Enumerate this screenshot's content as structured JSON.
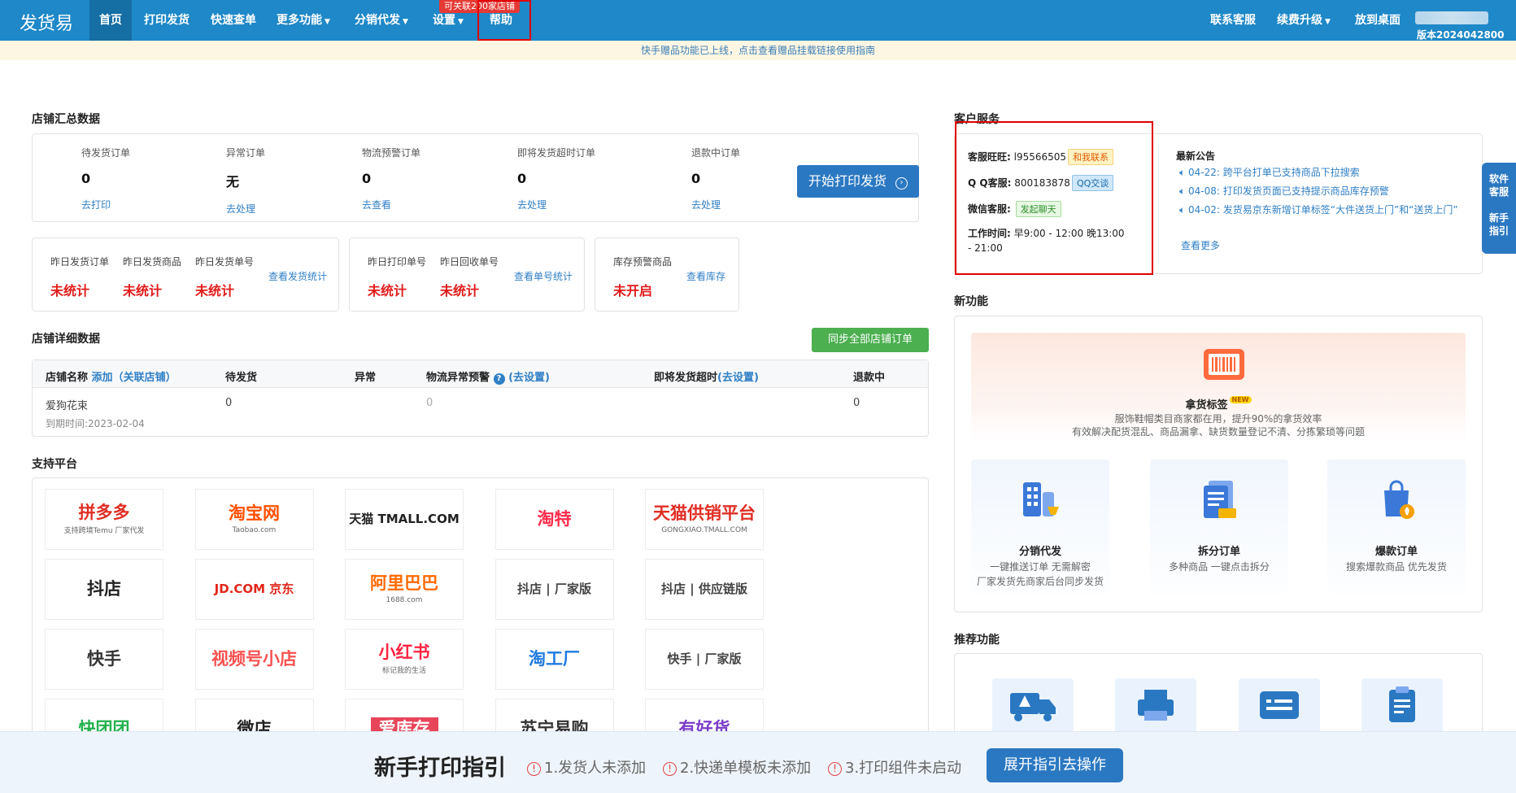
{
  "navbar": {
    "logo": "发货易",
    "items": [
      {
        "label": "首页"
      },
      {
        "label": "打印发货"
      },
      {
        "label": "快速查单"
      },
      {
        "label": "更多功能"
      },
      {
        "label": "分销代发"
      },
      {
        "label": "设置"
      },
      {
        "label": "帮助"
      }
    ],
    "promo_badge": "可关联200家店铺",
    "right_items": [
      {
        "label": "联系客服"
      },
      {
        "label": "续费升级"
      },
      {
        "label": "放到桌面"
      }
    ],
    "version": "版本2024042800"
  },
  "notice": "快手赠品功能已上线，点击查看赠品挂载链接使用指南",
  "summary": {
    "title": "店铺汇总数据",
    "stats": [
      {
        "label": "待发货订单",
        "value": "0",
        "action": "去打印"
      },
      {
        "label": "异常订单",
        "value": "无",
        "action": "去处理"
      },
      {
        "label": "物流预警订单",
        "value": "0",
        "action": "去查看"
      },
      {
        "label": "即将发货超时订单",
        "value": "0",
        "action": "去处理"
      },
      {
        "label": "退款中订单",
        "value": "0",
        "action": "去处理"
      }
    ],
    "start_button": "开始打印发货"
  },
  "yesterday_ship": {
    "items": [
      {
        "label": "昨日发货订单",
        "value": "未统计"
      },
      {
        "label": "昨日发货商品",
        "value": "未统计"
      },
      {
        "label": "昨日发货单号",
        "value": "未统计"
      }
    ],
    "link": "查看发货统计"
  },
  "yesterday_print": {
    "items": [
      {
        "label": "昨日打印单号",
        "value": "未统计"
      },
      {
        "label": "昨日回收单号",
        "value": "未统计"
      }
    ],
    "link": "查看单号统计"
  },
  "stock": {
    "items": [
      {
        "label": "库存预警商品",
        "value": "未开启"
      }
    ],
    "link": "查看库存"
  },
  "detail": {
    "title": "店铺详细数据",
    "sync_button": "同步全部店铺订单",
    "headers": {
      "shop": "店铺名称",
      "add": "添加",
      "link_shop": "（关联店铺）",
      "pending": "待发货",
      "abnormal": "异常",
      "logistics": "物流异常预警",
      "logistics_hint": "?",
      "logistics_set": "(去设置)",
      "timeout": "即将发货超时",
      "timeout_set": "(去设置)",
      "refund": "退款中"
    },
    "row": {
      "shop": "爱狗花束",
      "expire": "到期时间:2023-02-04",
      "pending": "0",
      "logistics": "0",
      "refund": "0"
    }
  },
  "platforms": {
    "title": "支持平台",
    "items": [
      {
        "label": "拼多多",
        "sub": "支持跨境Temu 厂家代发",
        "color": "#e02e24"
      },
      {
        "label": "淘宝网",
        "sub": "Taobao.com",
        "color": "#ff5000"
      },
      {
        "label": "天猫 TMALL.COM",
        "sub": "",
        "color": "#222222"
      },
      {
        "label": "淘特",
        "sub": "",
        "color": "#ff2a4a"
      },
      {
        "label": "天猫供销平台",
        "sub": "GONGXIAO.TMALL.COM",
        "color": "#e02e24"
      },
      {
        "label": "抖店",
        "sub": "",
        "color": "#222222"
      },
      {
        "label": "JD.COM 京东",
        "sub": "",
        "color": "#e1251b"
      },
      {
        "label": "阿里巴巴",
        "sub": "1688.com",
        "color": "#ff6a00"
      },
      {
        "label": "抖店 | 厂家版",
        "sub": "",
        "color": "#444444"
      },
      {
        "label": "抖店 | 供应链版",
        "sub": "",
        "color": "#444444"
      },
      {
        "label": "快手",
        "sub": "",
        "color": "#333333"
      },
      {
        "label": "视频号小店",
        "sub": "",
        "color": "#fa5151"
      },
      {
        "label": "小红书",
        "sub": "标记我的生活",
        "color": "#ff2442"
      },
      {
        "label": "淘工厂",
        "sub": "",
        "color": "#1f7ae0"
      },
      {
        "label": "快手 | 厂家版",
        "sub": "",
        "color": "#444444"
      },
      {
        "label": "快团团",
        "sub": "",
        "color": "#22b14c"
      },
      {
        "label": "微店",
        "sub": "",
        "color": "#222222"
      },
      {
        "label": "爱库存",
        "sub": "",
        "color": "#ffffff"
      },
      {
        "label": "苏宁易购",
        "sub": "",
        "color": "#333333"
      },
      {
        "label": "有好货",
        "sub": "",
        "color": "#7a3cc8"
      }
    ]
  },
  "customer_service": {
    "title": "客户服务",
    "wangwang_label": "客服旺旺:",
    "wangwang_id": "l95566505",
    "wangwang_btn": "和我联系",
    "qq_label": "Q Q客服:",
    "qq_id": "800183878",
    "qq_btn": "QQ交谈",
    "wechat_label": "微信客服:",
    "wechat_btn": "发起聊天",
    "hours_label": "工作时间:",
    "hours": "早9:00 - 12:00 晚13:00 - 21:00",
    "announce_title": "最新公告",
    "announcements": [
      "04-22: 跨平台打单已支持商品下拉搜索",
      "04-08: 打印发货页面已支持提示商品库存预警",
      "04-02: 发货易京东新增订单标签“大件送货上门”和“送货上门”"
    ],
    "more": "查看更多"
  },
  "side_tab": {
    "line1": "软件客服",
    "line2": "新手指引"
  },
  "new_features": {
    "title": "新功能",
    "hero_title": "拿货标签",
    "hero_tag": "NEW",
    "hero_line1": "服饰鞋帽类目商家都在用，提升90%的拿货效率",
    "hero_line2": "有效解决配货混乱、商品漏拿、缺货数量登记不清、分拣繁琐等问题",
    "cards": [
      {
        "title": "分销代发",
        "desc1": "一键推送订单 无需解密",
        "desc2": "厂家发货先商家后台同步发货"
      },
      {
        "title": "拆分订单",
        "desc1": "多种商品 一键点击拆分",
        "desc2": ""
      },
      {
        "title": "爆款订单",
        "desc1": "搜索爆款商品 优先发货",
        "desc2": ""
      }
    ]
  },
  "recommend": {
    "title": "推荐功能"
  },
  "guide": {
    "title": "新手打印指引",
    "items": [
      "1.发货人未添加",
      "2.快递单模板未添加",
      "3.打印组件未启动"
    ],
    "button": "展开指引去操作"
  },
  "colors": {
    "primary": "#1e88c8",
    "accent_blue": "#2b78c2",
    "alert_red": "#e21b1b",
    "green": "#4caf50"
  }
}
